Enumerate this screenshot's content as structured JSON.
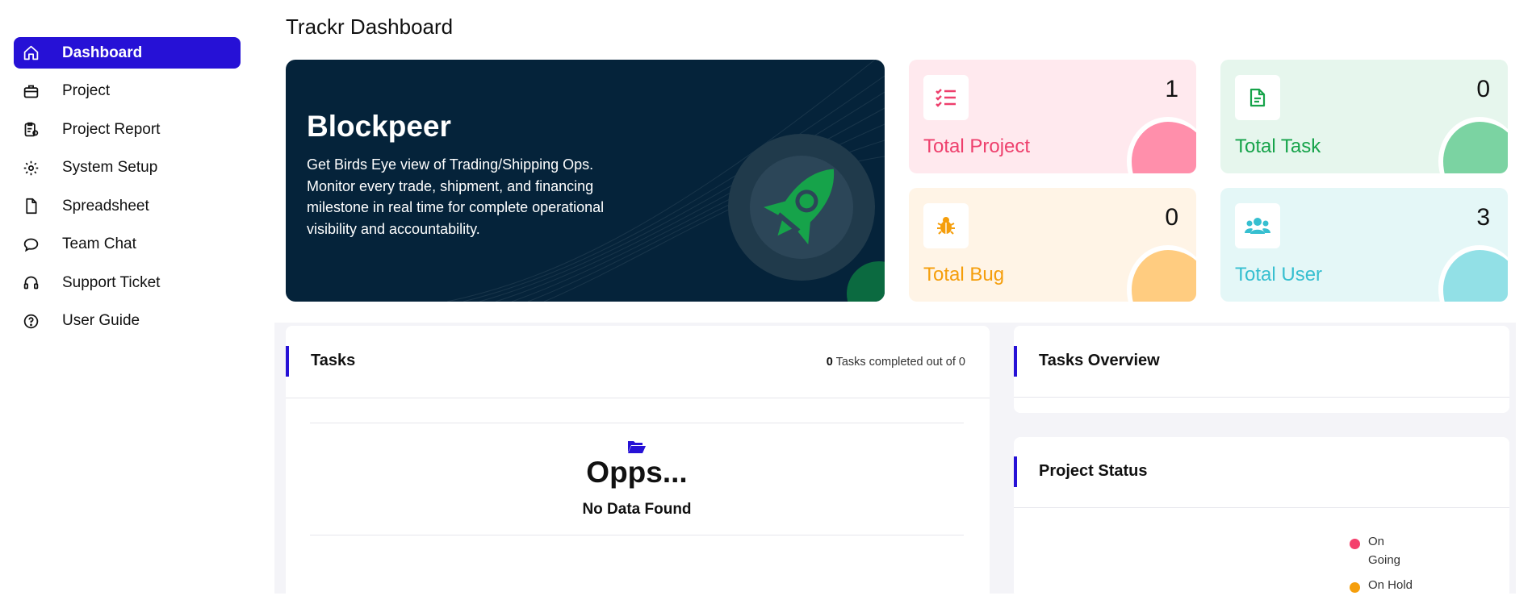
{
  "sidebar": {
    "items": [
      {
        "label": "Dashboard",
        "icon": "home-icon",
        "active": true
      },
      {
        "label": "Project",
        "icon": "briefcase-icon"
      },
      {
        "label": "Project Report",
        "icon": "clipboard-report-icon"
      },
      {
        "label": "System Setup",
        "icon": "gear-icon"
      },
      {
        "label": "Spreadsheet",
        "icon": "file-icon"
      },
      {
        "label": "Team Chat",
        "icon": "chat-bubble-icon"
      },
      {
        "label": "Support Ticket",
        "icon": "headphones-icon"
      },
      {
        "label": "User Guide",
        "icon": "question-circle-icon"
      }
    ]
  },
  "page": {
    "title": "Trackr Dashboard"
  },
  "hero": {
    "title": "Blockpeer",
    "description": "Get Birds Eye view of Trading/Shipping Ops. Monitor every trade, shipment, and financing milestone in real time for complete operational visibility and accountability.",
    "icon": "rocket-icon",
    "colors": {
      "bg": "#05233a",
      "accent": "#16a34a"
    }
  },
  "stats": [
    {
      "label": "Total Project",
      "value": "1",
      "icon": "checklist-icon",
      "bg": "#ffe9ee",
      "fg": "#ee3f6c",
      "blob": "#ff8fab"
    },
    {
      "label": "Total Task",
      "value": "0",
      "icon": "document-icon",
      "bg": "#e6f6ed",
      "fg": "#16a34a",
      "blob": "#7bd3a2"
    },
    {
      "label": "Total Bug",
      "value": "0",
      "icon": "bug-icon",
      "bg": "#fff4e6",
      "fg": "#f59e0b",
      "blob": "#ffcc80"
    },
    {
      "label": "Total User",
      "value": "3",
      "icon": "users-icon",
      "bg": "#e4f7f7",
      "fg": "#36bfd0",
      "blob": "#92e0e6"
    }
  ],
  "tasks": {
    "title": "Tasks",
    "completed": "0",
    "completed_text": "Tasks completed out of 0",
    "empty_title": "Opps...",
    "empty_text": "No Data Found",
    "empty_icon": "folder-open-icon"
  },
  "overview": {
    "title": "Tasks Overview"
  },
  "project_status": {
    "title": "Project Status",
    "legend": [
      {
        "label": "On Going",
        "color": "#f43f6c"
      },
      {
        "label": "On Hold",
        "color": "#f59e0b"
      }
    ]
  },
  "colors": {
    "accent": "#2611d6"
  }
}
